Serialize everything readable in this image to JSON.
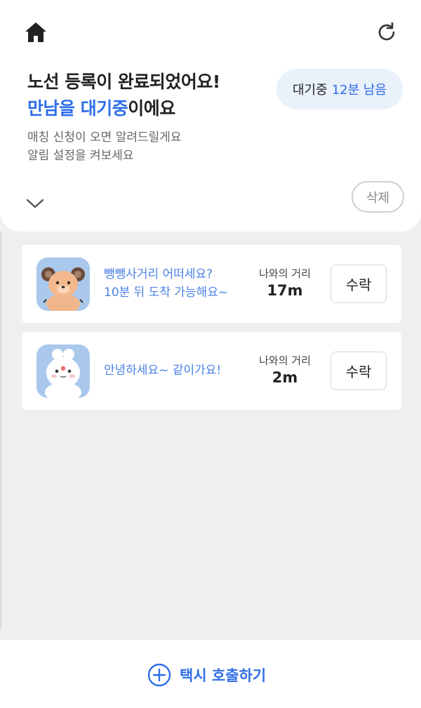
{
  "header": {
    "home_icon": "home-icon",
    "refresh_icon": "refresh-icon",
    "title_line1": "노선 등록이 완료되었어요!",
    "title_accent": "만남을 대기중",
    "title_suffix": "이에요",
    "wait_label": "대기중",
    "wait_remaining": "12분 남음",
    "subtitle_line1": "매칭 신청이 오면 알려드릴게요",
    "subtitle_line2": "알림 설정을 켜보세요",
    "delete_label": "삭제"
  },
  "requests": [
    {
      "avatar": "bear-avatar",
      "message_line1": "뺑뺑사거리 어떠세요?",
      "message_line2": "10분 뒤 도착 가능해요~",
      "distance_label": "나와의 거리",
      "distance_value": "17m",
      "accept_label": "수락"
    },
    {
      "avatar": "bunny-avatar",
      "message_line1": "안녕하세요~ 같이가요!",
      "message_line2": "",
      "distance_label": "나와의 거리",
      "distance_value": "2m",
      "accept_label": "수락"
    }
  ],
  "bottom": {
    "call_taxi_label": "택시 호출하기"
  },
  "colors": {
    "accent": "#2f6ee8",
    "background": "#efefef",
    "pill_background": "#e9f1fb",
    "message_text": "#4b82e6"
  }
}
